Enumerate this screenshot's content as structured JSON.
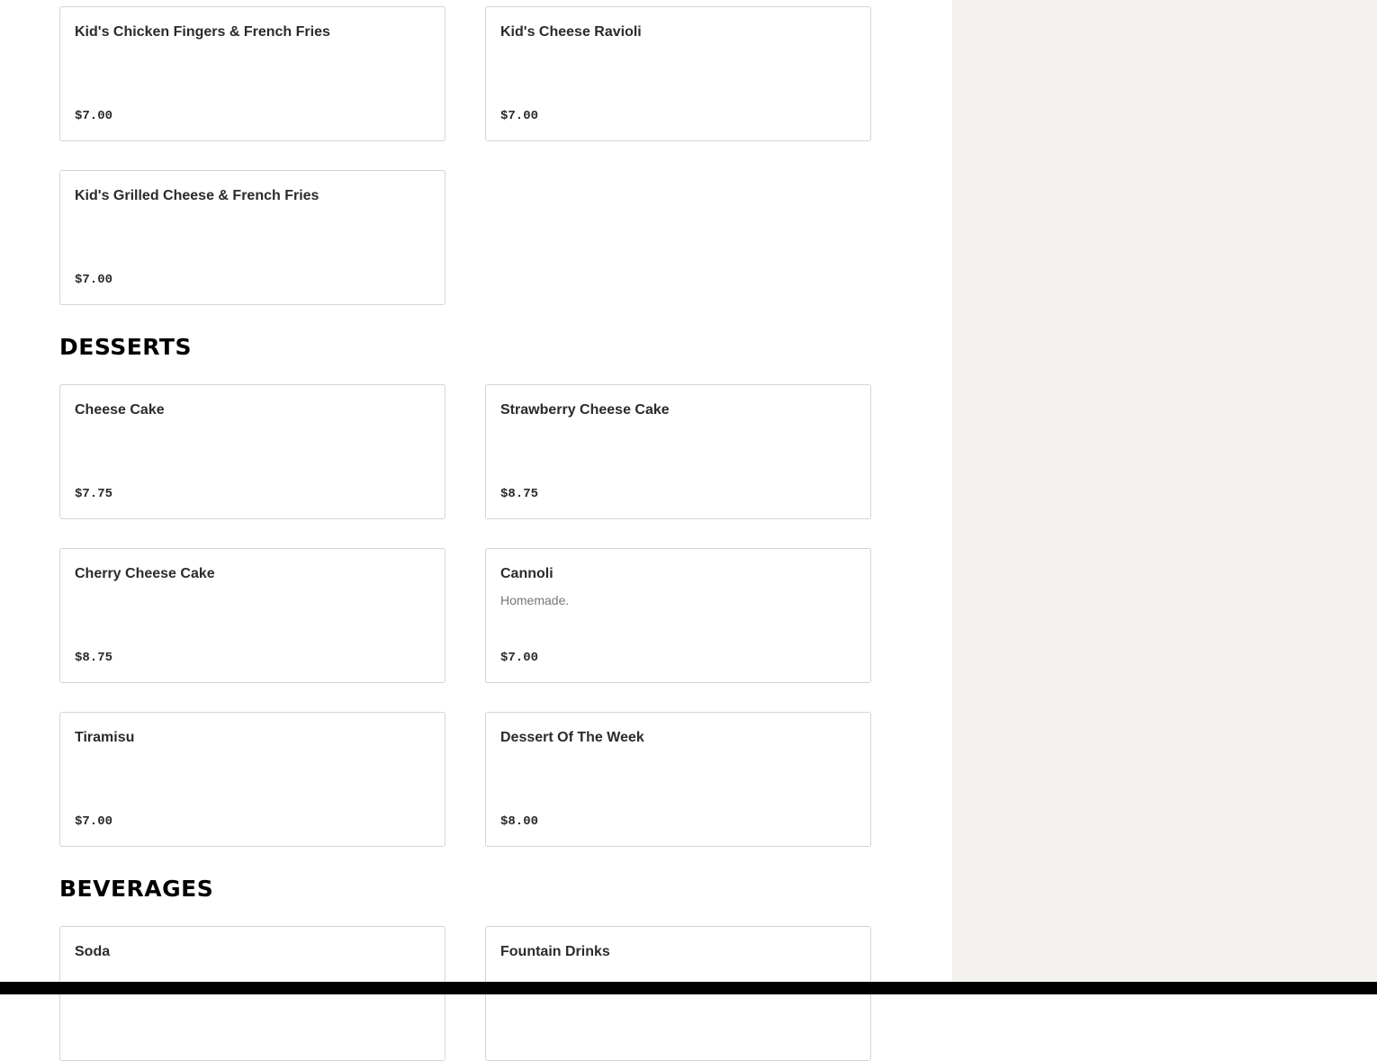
{
  "kids": {
    "items": [
      {
        "name": "Kid's Chicken Fingers & French Fries",
        "price": "$7.00"
      },
      {
        "name": "Kid's Cheese Ravioli",
        "price": "$7.00"
      },
      {
        "name": "Kid's Grilled Cheese & French Fries",
        "price": "$7.00"
      }
    ]
  },
  "desserts": {
    "title": "DESSERTS",
    "items": [
      {
        "name": "Cheese Cake",
        "price": "$7.75"
      },
      {
        "name": "Strawberry Cheese Cake",
        "price": "$8.75"
      },
      {
        "name": "Cherry Cheese Cake",
        "price": "$8.75"
      },
      {
        "name": "Cannoli",
        "description": "Homemade.",
        "price": "$7.00"
      },
      {
        "name": "Tiramisu",
        "price": "$7.00"
      },
      {
        "name": "Dessert Of The Week",
        "price": "$8.00"
      }
    ]
  },
  "beverages": {
    "title": "BEVERAGES",
    "items": [
      {
        "name": "Soda"
      },
      {
        "name": "Fountain Drinks"
      }
    ]
  }
}
